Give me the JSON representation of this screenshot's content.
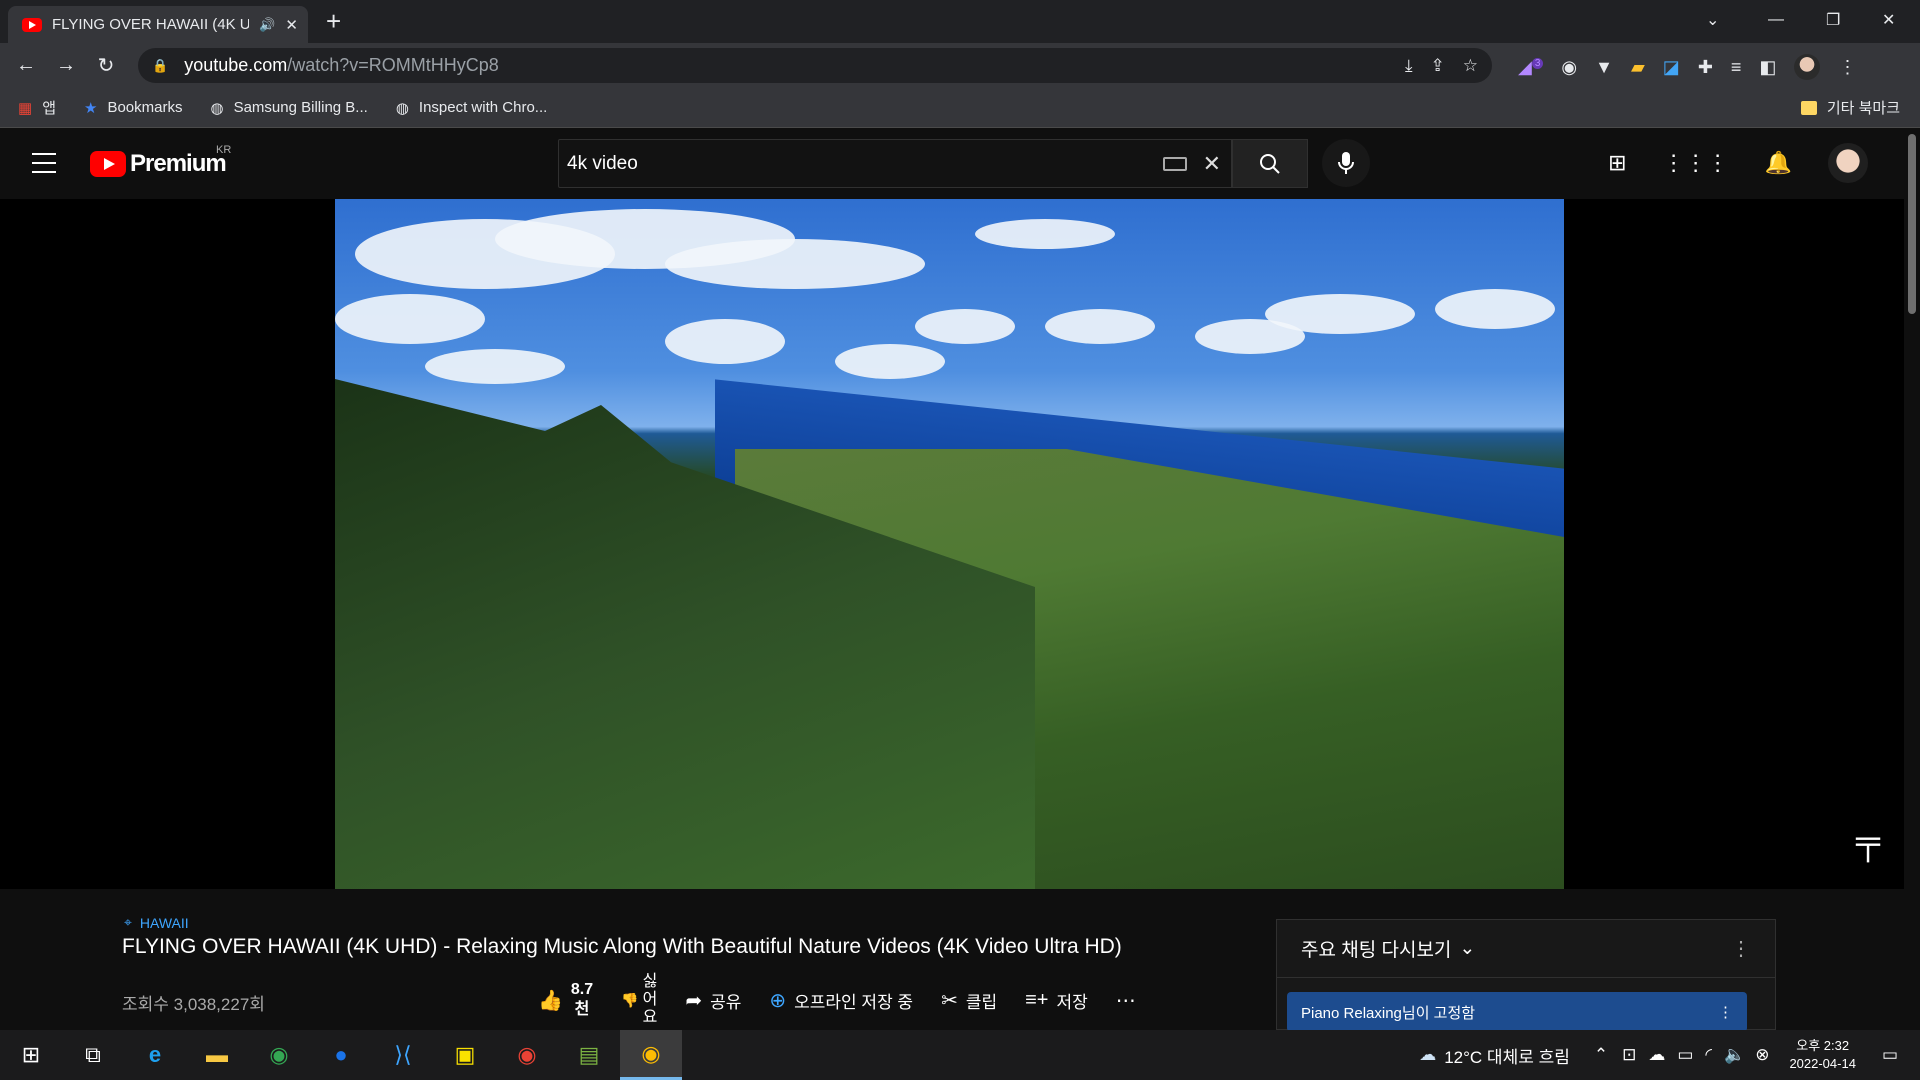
{
  "browser": {
    "tab_title": "FLYING OVER HAWAII (4K U",
    "url_domain": "youtube.com",
    "url_path": "/watch?v=ROMMtHHyCp8",
    "bookmarks": [
      "앱",
      "Bookmarks",
      "Samsung Billing B...",
      "Inspect with Chro..."
    ],
    "other_bookmarks": "기타 북마크",
    "ext_badge": "3"
  },
  "youtube": {
    "logo_text": "Premium",
    "region": "KR",
    "search_value": "4k video",
    "video": {
      "location": "HAWAII",
      "title": "FLYING OVER HAWAII (4K UHD) - Relaxing Music Along With Beautiful Nature Videos (4K Video Ultra HD)",
      "views": "조회수 3,038,227회",
      "likes_num": "8.7",
      "likes_unit": "천",
      "dislike_label": [
        "싫",
        "어",
        "요"
      ],
      "share": "공유",
      "download": "오프라인 저장 중",
      "clip": "클립",
      "save": "저장"
    },
    "chat": {
      "title": "주요 채팅 다시보기",
      "pinned": "Piano Relaxing님이 고정함"
    }
  },
  "taskbar": {
    "weather": "12°C  대체로 흐림",
    "time": "오후 2:32",
    "date": "2022-04-14"
  }
}
